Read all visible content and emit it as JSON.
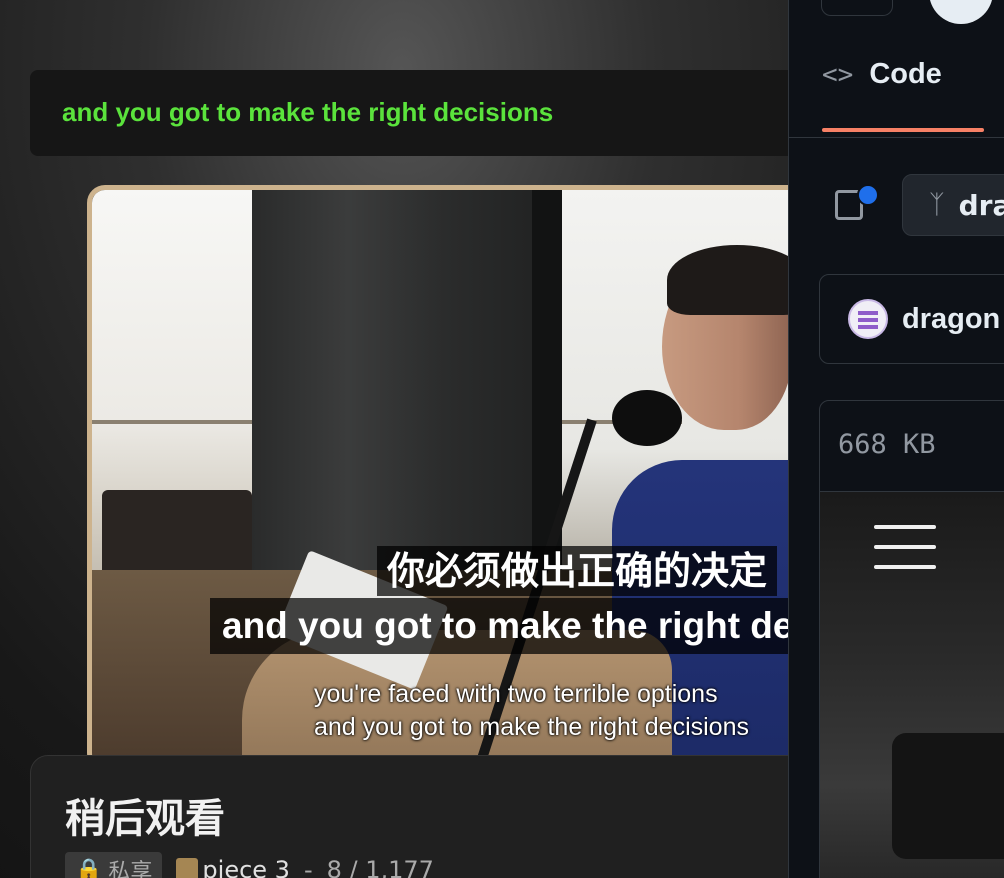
{
  "player": {
    "caption_bar_text": "and you got to make the right decisions",
    "subtitle_cn": "你必须做出正确的决定",
    "subtitle_en": "and you got to make the right decisions",
    "subtitle_small_line1": "you're faced with two terrible options",
    "subtitle_small_line2": "and you got to make the right decisions"
  },
  "watch_later": {
    "title": "稍后观看",
    "privacy": "私享",
    "playlist_name": "piece 3",
    "separator": "-",
    "count": "8 / 1,177"
  },
  "github": {
    "tab_code": "Code",
    "branch": "dragon",
    "repo_owner": "dragon",
    "file_size": "668 KB"
  },
  "colors": {
    "caption_green": "#5be33c",
    "frame_border": "#cdb38d",
    "gh_bg": "#0d1117",
    "tab_underline": "#f78166",
    "notification_dot": "#1f6feb"
  }
}
